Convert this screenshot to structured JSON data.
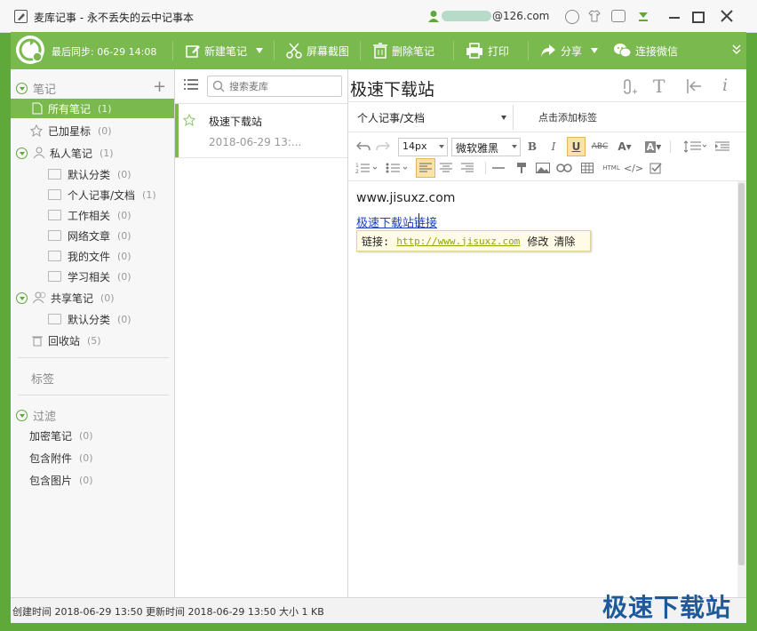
{
  "window": {
    "title": "麦库记事 - 永不丢失的云中记事本",
    "account": "@126.com"
  },
  "toolbar": {
    "sync_label": "最后同步: 06-29 14:08",
    "new_note": "新建笔记",
    "screenshot": "屏幕截图",
    "delete_note": "删除笔记",
    "print": "打印",
    "share": "分享",
    "wechat": "连接微信"
  },
  "sidebar": {
    "notes_header": "笔记",
    "all_notes": {
      "label": "所有笔记",
      "count": "(1)"
    },
    "starred": {
      "label": "已加星标",
      "count": "(0)"
    },
    "private": {
      "label": "私人笔记",
      "count": "(1)"
    },
    "private_folders": [
      {
        "label": "默认分类",
        "count": "(0)"
      },
      {
        "label": "个人记事/文档",
        "count": "(1)"
      },
      {
        "label": "工作相关",
        "count": "(0)"
      },
      {
        "label": "网络文章",
        "count": "(0)"
      },
      {
        "label": "我的文件",
        "count": "(0)"
      },
      {
        "label": "学习相关",
        "count": "(0)"
      }
    ],
    "shared": {
      "label": "共享笔记",
      "count": "(0)"
    },
    "shared_folders": [
      {
        "label": "默认分类",
        "count": "(0)"
      }
    ],
    "trash": {
      "label": "回收站",
      "count": "(5)"
    },
    "tags_header": "标签",
    "filter_header": "过滤",
    "filters": [
      {
        "label": "加密笔记",
        "count": "(0)"
      },
      {
        "label": "包含附件",
        "count": "(0)"
      },
      {
        "label": "包含图片",
        "count": "(0)"
      }
    ]
  },
  "notelist": {
    "search_placeholder": "搜索麦库",
    "items": [
      {
        "title": "极速下载站",
        "date": "2018-06-29 13:..."
      }
    ]
  },
  "editor": {
    "title": "极速下载站",
    "category": "个人记事/文档",
    "tag_placeholder": "点击添加标签",
    "font_size": "14px",
    "font_name": "微软雅黑",
    "body_line1": "www.jisuxz.com",
    "link_text": "极速下载站链接",
    "popup_label": "链接:",
    "popup_url": "http://www.jisuxz.com",
    "popup_edit": "修改",
    "popup_clear": "清除"
  },
  "statusbar": {
    "created": "创建时间 2018-06-29 13:50",
    "updated": "更新时间 2018-06-29 13:50",
    "size": "大小 1 KB"
  },
  "watermark": "极速下载站",
  "colors": {
    "accent": "#79b94e",
    "frame": "#5fa83a",
    "link": "#1a3fc0"
  }
}
